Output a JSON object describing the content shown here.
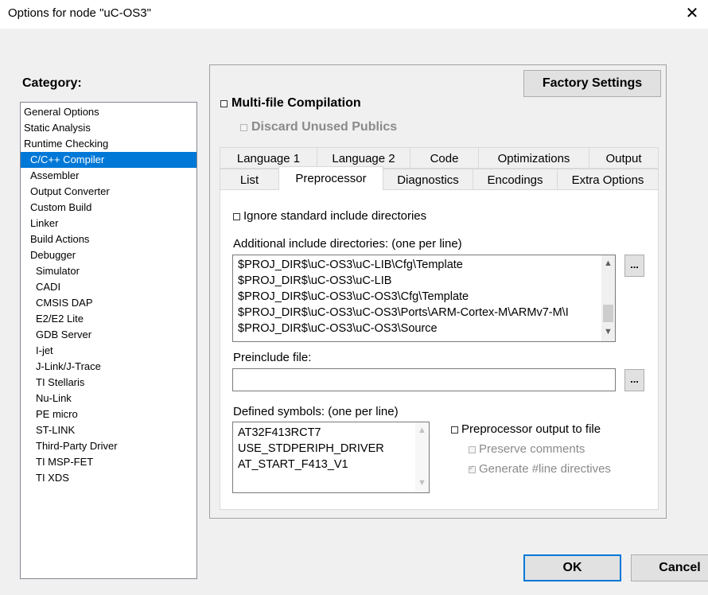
{
  "window": {
    "title": "Options for node \"uC-OS3\"",
    "close": "✕"
  },
  "category": {
    "label": "Category:",
    "items": [
      "General Options",
      "Static Analysis",
      "Runtime Checking",
      "C/C++ Compiler",
      "Assembler",
      "Output Converter",
      "Custom Build",
      "Linker",
      "Build Actions",
      "Debugger",
      "Simulator",
      "CADI",
      "CMSIS DAP",
      "E2/E2 Lite",
      "GDB Server",
      "I-jet",
      "J-Link/J-Trace",
      "TI Stellaris",
      "Nu-Link",
      "PE micro",
      "ST-LINK",
      "Third-Party Driver",
      "TI MSP-FET",
      "TI XDS"
    ],
    "selected": "C/C++ Compiler"
  },
  "factory_settings": "Factory Settings",
  "multifile": {
    "label": "Multi-file Compilation",
    "checked": false
  },
  "discard": {
    "label": "Discard Unused Publics",
    "checked": false,
    "disabled": true
  },
  "tabs": {
    "row1": [
      "Language 1",
      "Language 2",
      "Code",
      "Optimizations",
      "Output"
    ],
    "row2": [
      "List",
      "Preprocessor",
      "Diagnostics",
      "Encodings",
      "Extra Options"
    ],
    "active": "Preprocessor"
  },
  "preprocessor": {
    "ignore_std": {
      "label": "Ignore standard include directories",
      "checked": false
    },
    "include_dirs_label": "Additional include directories: (one per line)",
    "include_dirs": [
      "$PROJ_DIR$\\uC-OS3\\uC-LIB\\Cfg\\Template",
      "$PROJ_DIR$\\uC-OS3\\uC-LIB",
      "$PROJ_DIR$\\uC-OS3\\uC-OS3\\Cfg\\Template",
      "$PROJ_DIR$\\uC-OS3\\uC-OS3\\Ports\\ARM-Cortex-M\\ARMv7-M\\I",
      "$PROJ_DIR$\\uC-OS3\\uC-OS3\\Source"
    ],
    "browse": "...",
    "preinclude_label": "Preinclude file:",
    "preinclude_value": "",
    "defined_label": "Defined symbols: (one per line)",
    "defined_symbols": [
      "AT32F413RCT7",
      "USE_STDPERIPH_DRIVER",
      "AT_START_F413_V1"
    ],
    "output_to_file": {
      "label": "Preprocessor output to file",
      "checked": false
    },
    "preserve_comments": {
      "label": "Preserve comments",
      "checked": false,
      "disabled": true
    },
    "line_directives": {
      "label": "Generate #line directives",
      "checked": true,
      "disabled": true
    }
  },
  "buttons": {
    "ok": "OK",
    "cancel": "Cancel"
  }
}
